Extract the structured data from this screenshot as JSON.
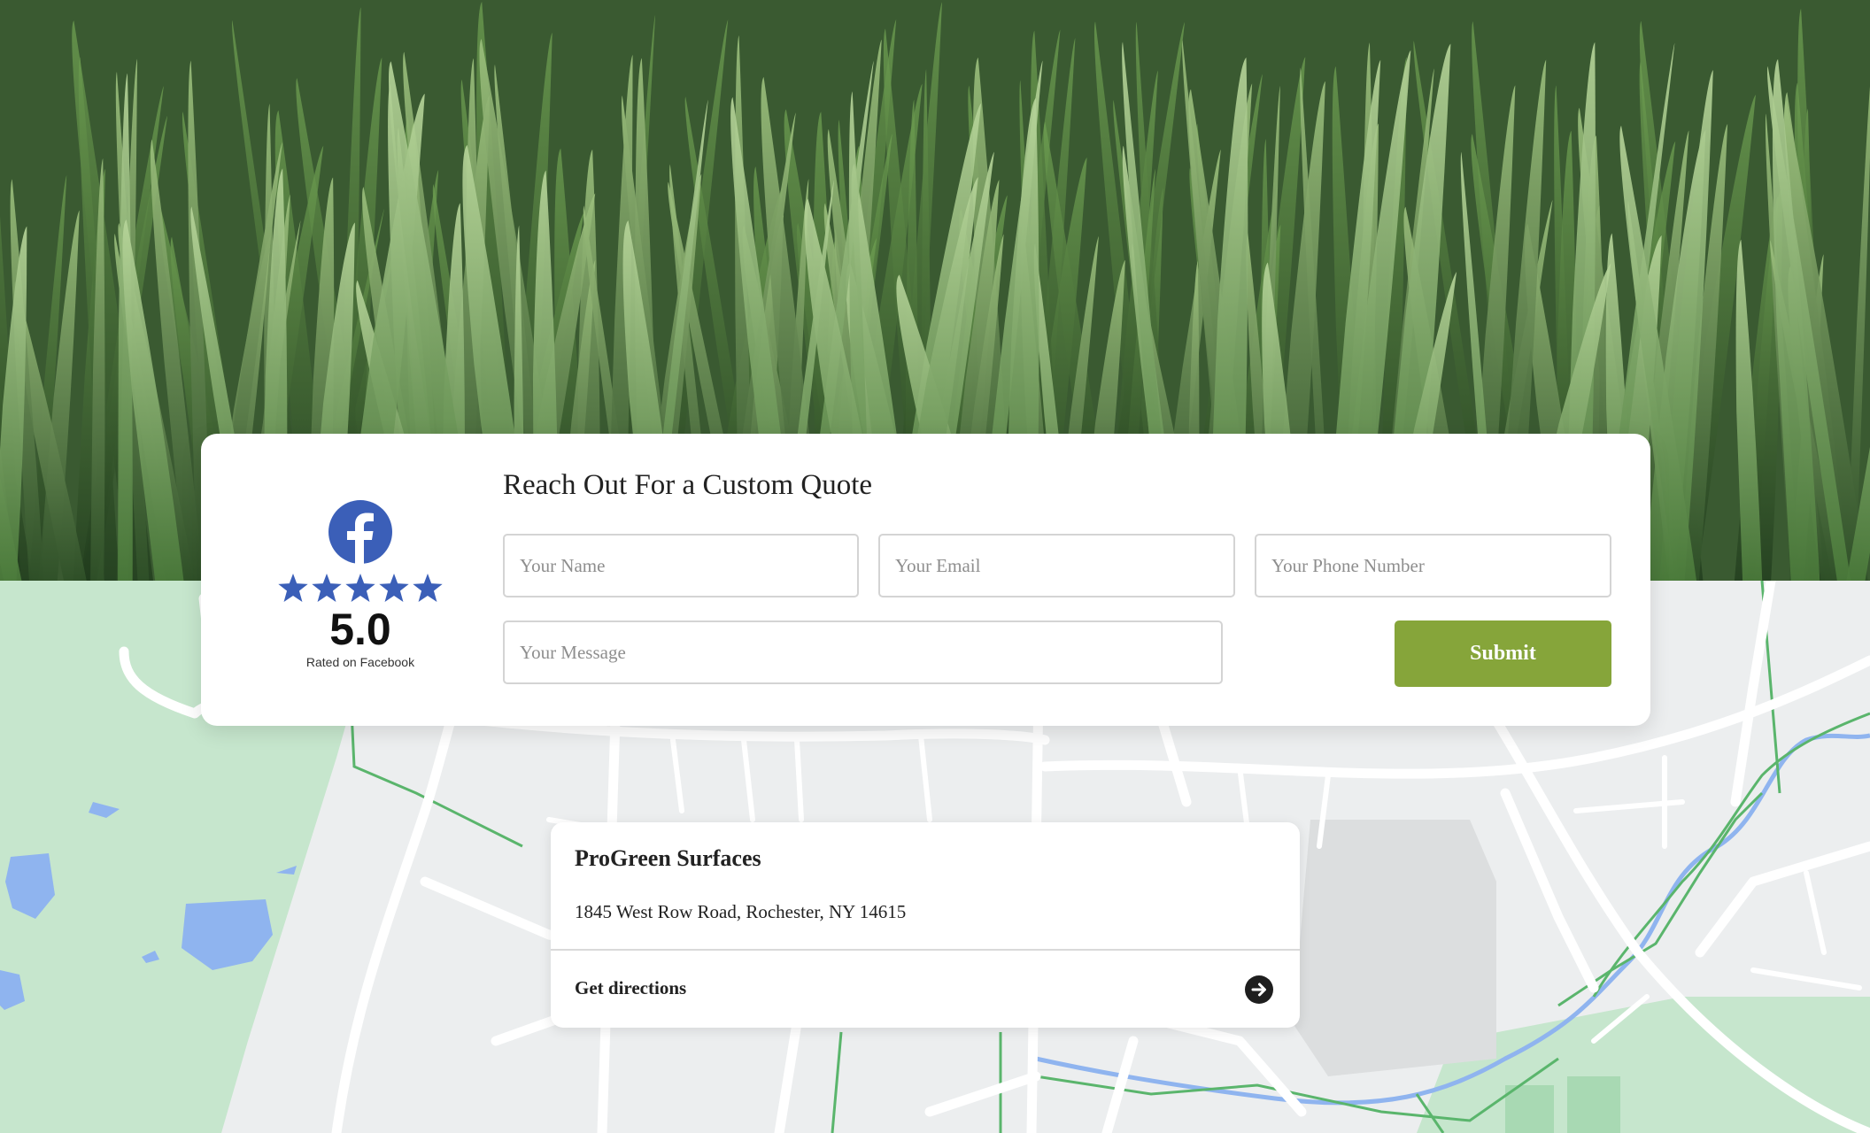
{
  "hero": {
    "image": "grass-closeup-photo"
  },
  "quote_form": {
    "rating": {
      "platform_icon": "facebook-icon",
      "stars": 5,
      "value": "5.0",
      "caption": "Rated on Facebook"
    },
    "title": "Reach Out For a Custom Quote",
    "name_placeholder": "Your Name",
    "email_placeholder": "Your Email",
    "phone_placeholder": "Your Phone Number",
    "message_placeholder": "Your Message",
    "submit_label": "Submit"
  },
  "location": {
    "name": "ProGreen Surfaces",
    "address": "1845 West Row Road, Rochester, NY 14615",
    "directions_label": "Get directions",
    "directions_icon": "arrow-right-circle-icon"
  },
  "colors": {
    "accent": "#86a53a",
    "facebook": "#3b5fb8",
    "star": "#3b5fb8",
    "map_park": "#c6e6cd",
    "map_water": "#8fb4ef",
    "map_trail": "#5ab56c"
  }
}
